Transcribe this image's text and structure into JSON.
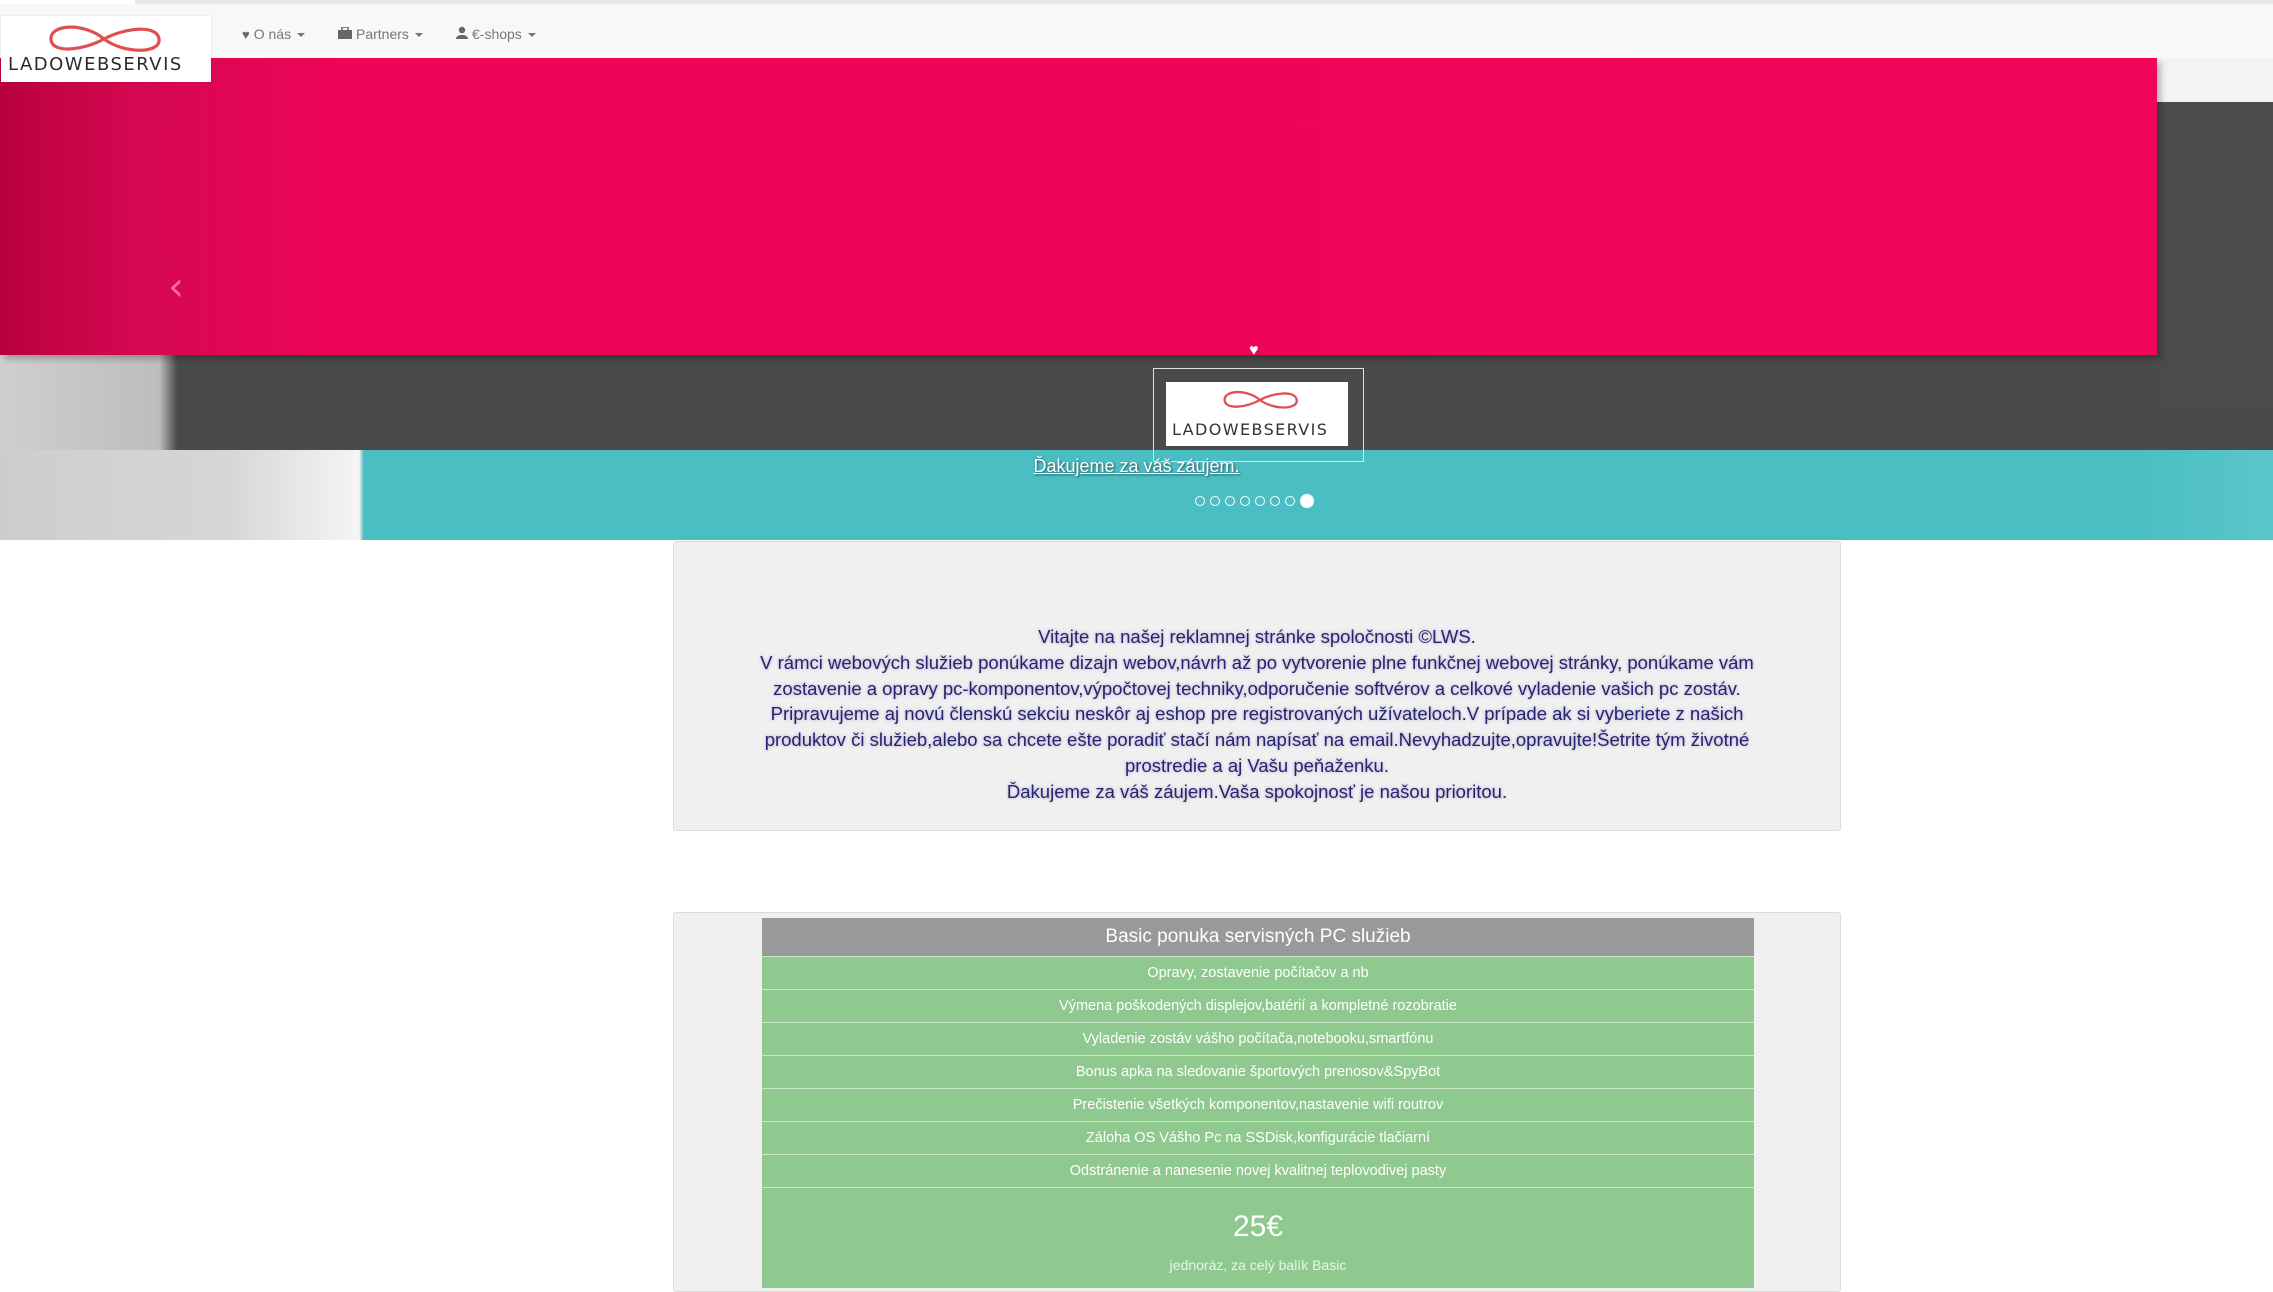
{
  "brand": {
    "logo_text": "LADOWEBSERVIS"
  },
  "nav": {
    "items": [
      {
        "label": "O nás",
        "icon": "heart-icon"
      },
      {
        "label": "Partners",
        "icon": "briefcase-icon"
      },
      {
        "label": "€-shops",
        "icon": "user-icon"
      }
    ]
  },
  "carousel": {
    "prev_label": "‹",
    "caption_logo_text": "LADOWEBSERVIS",
    "caption": "Ďakujeme za váš záujem.",
    "slide_count": 8,
    "active_slide": 8,
    "colors": {
      "pink": "#f0055a",
      "gray": "#4a4a4a",
      "teal": "#4bbec4"
    }
  },
  "welcome": {
    "lines": [
      "Vitajte na našej reklamnej stránke spoločnosti ©LWS.",
      "V rámci webových služieb ponúkame dizajn webov,návrh až po vytvorenie plne funkčnej webovej stránky, ponúkame vám",
      "zostavenie a opravy pc-komponentov,výpočtovej techniky,odporučenie softvérov a celkové vyladenie vašich pc zostáv.",
      "Pripravujeme aj novú členskú sekciu neskôr aj eshop pre registrovaných užívateloch.V prípade ak si vyberiete z našich",
      "produktov či služieb,alebo sa chcete ešte poradiť stačí nám napísať na email.Nevyhadzujte,opravujte!Šetrite tým životné",
      "prostredie a aj Vašu peňaženku.",
      "Ďakujeme za váš záujem.Vaša spokojnosť je našou prioritou."
    ]
  },
  "pricing": {
    "title": "Basic ponuka servisných PC služieb",
    "items": [
      "Opravy, zostavenie počítačov a nb",
      "Výmena poškodených displejov,batérií a kompletné rozobratie",
      "Vyladenie zostáv vášho počítača,notebooku,smartfónu",
      "Bonus apka na sledovanie športových prenosov&SpyBot",
      "Prečistenie všetkých komponentov,nastavenie wifi routrov",
      "Záloha OS Vášho Pc na SSDisk,konfigurácie tlačiarní",
      "Odstránenie a nanesenie novej kvalitnej teplovodivej pasty"
    ],
    "price": "25€",
    "price_note": "jednoráz, za celý balík Basic",
    "colors": {
      "header": "#999999",
      "rows": "#8fc98f"
    }
  }
}
